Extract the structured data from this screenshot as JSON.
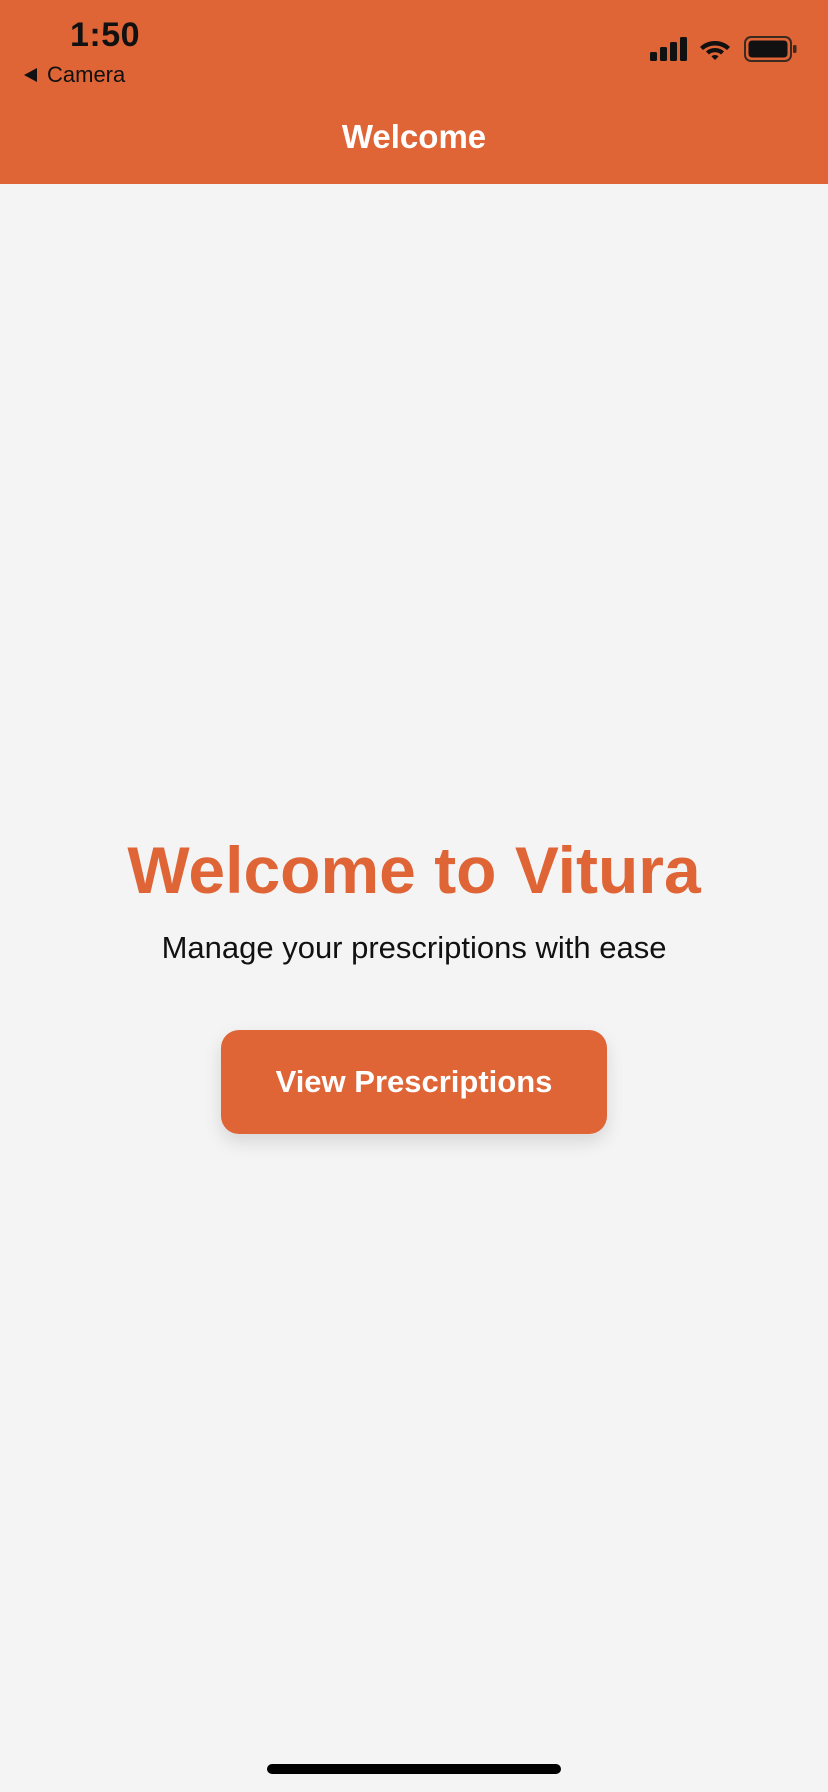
{
  "status_bar": {
    "time": "1:50",
    "back_app": "Camera",
    "icons": [
      "signal-icon",
      "wifi-icon",
      "battery-icon"
    ]
  },
  "nav": {
    "title": "Welcome"
  },
  "main": {
    "heading": "Welcome to Vitura",
    "subtitle": "Manage your prescriptions with ease",
    "cta_label": "View Prescriptions"
  },
  "colors": {
    "accent": "#df6436",
    "background": "#f4f4f4",
    "text": "#111111"
  }
}
